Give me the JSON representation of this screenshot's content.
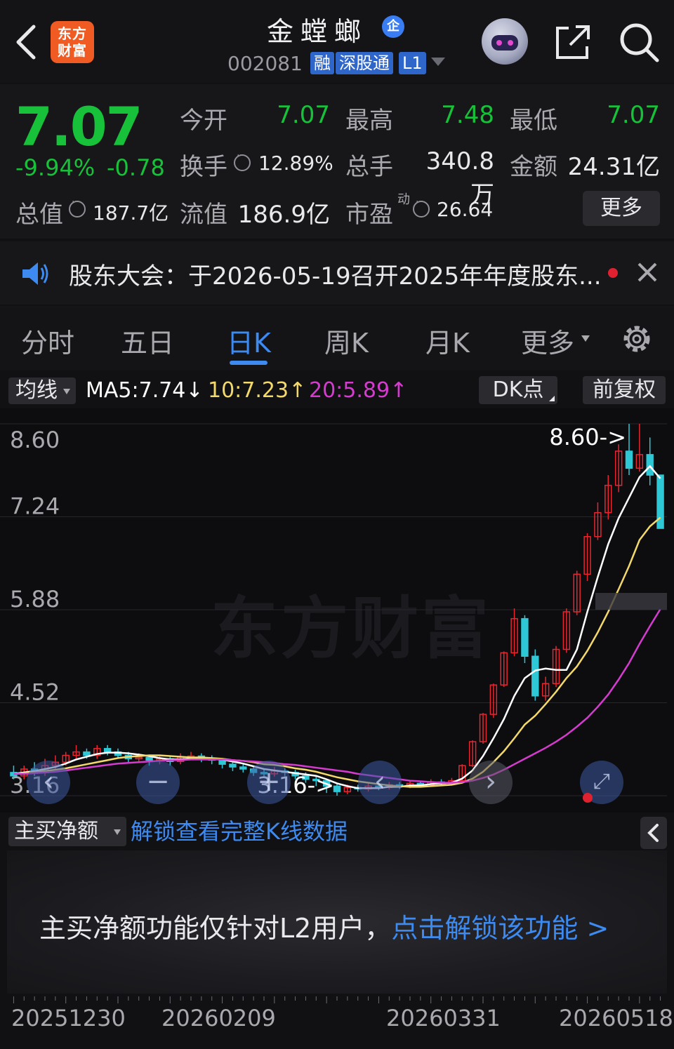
{
  "header": {
    "logo_text_line1": "东方",
    "logo_text_line2": "财富",
    "stock_name": "金螳螂",
    "enterprise_badge": "企",
    "stock_code": "002081",
    "tags": [
      "融",
      "深股通",
      "L1"
    ]
  },
  "quote": {
    "price": "7.07",
    "change_pct": "-9.94%",
    "change_amt": "-0.78",
    "open_label": "今开",
    "open": "7.07",
    "high_label": "最高",
    "high": "7.48",
    "low_label": "最低",
    "low": "7.07",
    "turnover_label": "换手",
    "turnover": "12.89%",
    "volume_label": "总手",
    "volume": "340.8万",
    "amount_label": "金额",
    "amount": "24.31亿",
    "mktcap_label": "总值",
    "mktcap": "187.7亿",
    "float_label": "流值",
    "float_cap": "186.9亿",
    "pe_label": "市盈",
    "pe_sup": "动",
    "pe": "26.64",
    "more_label": "更多"
  },
  "notice": {
    "text": "股东大会：于2026-05-19召开2025年年度股东..."
  },
  "tabs": [
    "分时",
    "五日",
    "日K",
    "周K",
    "月K",
    "更多"
  ],
  "active_tab": "日K",
  "ma_bar": {
    "selector": "均线",
    "ma5": "MA5:7.74↓",
    "ma10": "10:7.23↑",
    "ma20": "20:5.89↑",
    "dk_label": "DK点",
    "adjust_label": "前复权",
    "colors": {
      "ma5": "#ffffff",
      "ma10": "#f3d96b",
      "ma20": "#d63bd0"
    }
  },
  "chart_data": {
    "type": "candlestick",
    "y_ticks": [
      "8.60",
      "7.24",
      "5.88",
      "4.52",
      "3.16"
    ],
    "ylim": [
      3.16,
      8.6
    ],
    "high_marker": "8.60->",
    "low_marker": "3.16->",
    "watermark": "东方财富",
    "x_ticks": [
      "20251230",
      "20260209",
      "20260331",
      "20260518"
    ],
    "up_color": "#e8262f",
    "down_color": "#2ec7d6",
    "candles": [
      [
        3.5,
        3.45,
        3.6,
        3.4
      ],
      [
        3.45,
        3.55,
        3.6,
        3.4
      ],
      [
        3.55,
        3.5,
        3.65,
        3.45
      ],
      [
        3.5,
        3.6,
        3.7,
        3.45
      ],
      [
        3.6,
        3.65,
        3.75,
        3.55
      ],
      [
        3.65,
        3.75,
        3.8,
        3.6
      ],
      [
        3.75,
        3.8,
        3.9,
        3.7
      ],
      [
        3.8,
        3.75,
        3.85,
        3.7
      ],
      [
        3.75,
        3.85,
        3.9,
        3.7
      ],
      [
        3.85,
        3.8,
        3.9,
        3.75
      ],
      [
        3.8,
        3.75,
        3.85,
        3.7
      ],
      [
        3.75,
        3.7,
        3.8,
        3.65
      ],
      [
        3.7,
        3.72,
        3.78,
        3.65
      ],
      [
        3.72,
        3.68,
        3.75,
        3.6
      ],
      [
        3.68,
        3.7,
        3.76,
        3.62
      ],
      [
        3.7,
        3.66,
        3.74,
        3.6
      ],
      [
        3.66,
        3.72,
        3.78,
        3.62
      ],
      [
        3.72,
        3.74,
        3.8,
        3.68
      ],
      [
        3.74,
        3.7,
        3.78,
        3.65
      ],
      [
        3.7,
        3.68,
        3.75,
        3.62
      ],
      [
        3.68,
        3.62,
        3.7,
        3.56
      ],
      [
        3.62,
        3.58,
        3.66,
        3.52
      ],
      [
        3.58,
        3.55,
        3.62,
        3.5
      ],
      [
        3.55,
        3.5,
        3.6,
        3.45
      ],
      [
        3.5,
        3.48,
        3.56,
        3.42
      ],
      [
        3.48,
        3.52,
        3.58,
        3.44
      ],
      [
        3.52,
        3.5,
        3.56,
        3.45
      ],
      [
        3.5,
        3.45,
        3.54,
        3.4
      ],
      [
        3.45,
        3.4,
        3.5,
        3.35
      ],
      [
        3.4,
        3.38,
        3.45,
        3.3
      ],
      [
        3.38,
        3.3,
        3.4,
        3.2
      ],
      [
        3.3,
        3.22,
        3.34,
        3.16
      ],
      [
        3.22,
        3.28,
        3.32,
        3.18
      ],
      [
        3.28,
        3.26,
        3.32,
        3.22
      ],
      [
        3.26,
        3.3,
        3.34,
        3.22
      ],
      [
        3.3,
        3.28,
        3.34,
        3.24
      ],
      [
        3.28,
        3.32,
        3.36,
        3.25
      ],
      [
        3.32,
        3.3,
        3.36,
        3.26
      ],
      [
        3.3,
        3.34,
        3.38,
        3.27
      ],
      [
        3.34,
        3.32,
        3.38,
        3.28
      ],
      [
        3.32,
        3.36,
        3.4,
        3.3
      ],
      [
        3.36,
        3.34,
        3.4,
        3.3
      ],
      [
        3.34,
        3.38,
        3.42,
        3.31
      ],
      [
        3.38,
        3.6,
        3.62,
        3.36
      ],
      [
        3.6,
        3.95,
        3.97,
        3.58
      ],
      [
        3.95,
        4.35,
        4.37,
        3.92
      ],
      [
        4.35,
        4.78,
        4.8,
        4.3
      ],
      [
        4.78,
        5.25,
        5.27,
        4.75
      ],
      [
        5.25,
        5.75,
        5.9,
        5.2
      ],
      [
        5.75,
        5.2,
        5.8,
        5.1
      ],
      [
        5.2,
        4.62,
        5.3,
        4.55
      ],
      [
        4.62,
        4.8,
        4.9,
        4.55
      ],
      [
        4.8,
        5.3,
        5.35,
        4.75
      ],
      [
        5.3,
        5.85,
        5.9,
        5.25
      ],
      [
        5.85,
        6.4,
        6.45,
        5.8
      ],
      [
        6.4,
        6.95,
        7.0,
        6.3
      ],
      [
        6.95,
        7.3,
        7.45,
        6.9
      ],
      [
        7.3,
        7.7,
        7.85,
        7.2
      ],
      [
        7.7,
        8.2,
        8.3,
        7.6
      ],
      [
        8.2,
        7.95,
        8.6,
        7.85
      ],
      [
        7.95,
        8.15,
        8.6,
        7.9
      ],
      [
        8.15,
        7.85,
        8.4,
        7.7
      ],
      [
        7.85,
        7.07,
        7.48,
        7.07
      ]
    ],
    "ma5": [
      3.48,
      3.5,
      3.52,
      3.55,
      3.58,
      3.63,
      3.69,
      3.73,
      3.77,
      3.79,
      3.79,
      3.78,
      3.76,
      3.74,
      3.71,
      3.69,
      3.69,
      3.7,
      3.7,
      3.7,
      3.69,
      3.66,
      3.63,
      3.59,
      3.55,
      3.53,
      3.51,
      3.49,
      3.47,
      3.45,
      3.4,
      3.34,
      3.3,
      3.27,
      3.27,
      3.27,
      3.29,
      3.29,
      3.31,
      3.31,
      3.33,
      3.34,
      3.35,
      3.41,
      3.53,
      3.74,
      4.0,
      4.28,
      4.62,
      4.88,
      4.99,
      5.02,
      5.0,
      5.0,
      5.3,
      5.85,
      6.36,
      6.84,
      7.22,
      7.52,
      7.82,
      7.98,
      7.8
    ],
    "ma10": [
      3.48,
      3.49,
      3.5,
      3.52,
      3.54,
      3.56,
      3.59,
      3.62,
      3.65,
      3.68,
      3.71,
      3.73,
      3.74,
      3.75,
      3.75,
      3.74,
      3.73,
      3.72,
      3.72,
      3.71,
      3.7,
      3.68,
      3.67,
      3.65,
      3.62,
      3.61,
      3.59,
      3.56,
      3.54,
      3.51,
      3.47,
      3.43,
      3.4,
      3.37,
      3.35,
      3.33,
      3.31,
      3.3,
      3.29,
      3.29,
      3.3,
      3.31,
      3.32,
      3.35,
      3.41,
      3.51,
      3.65,
      3.81,
      4.0,
      4.2,
      4.33,
      4.5,
      4.68,
      4.88,
      5.05,
      5.28,
      5.55,
      5.85,
      6.18,
      6.52,
      6.9,
      7.1,
      7.23
    ],
    "ma20": [
      3.48,
      3.48,
      3.49,
      3.5,
      3.51,
      3.53,
      3.55,
      3.57,
      3.59,
      3.61,
      3.63,
      3.64,
      3.65,
      3.66,
      3.67,
      3.68,
      3.68,
      3.69,
      3.69,
      3.69,
      3.69,
      3.68,
      3.67,
      3.66,
      3.65,
      3.64,
      3.62,
      3.61,
      3.59,
      3.57,
      3.55,
      3.53,
      3.51,
      3.48,
      3.46,
      3.44,
      3.42,
      3.4,
      3.38,
      3.37,
      3.36,
      3.35,
      3.35,
      3.36,
      3.38,
      3.42,
      3.47,
      3.54,
      3.62,
      3.7,
      3.78,
      3.86,
      3.95,
      4.05,
      4.17,
      4.3,
      4.46,
      4.64,
      4.86,
      5.1,
      5.38,
      5.64,
      5.89
    ]
  },
  "indicator": {
    "selector": "主买净额",
    "unlock_link": "解锁查看完整K线数据",
    "l2_text": "主买净额功能仅针对L2用户，",
    "l2_link": "点击解锁该功能 >"
  }
}
